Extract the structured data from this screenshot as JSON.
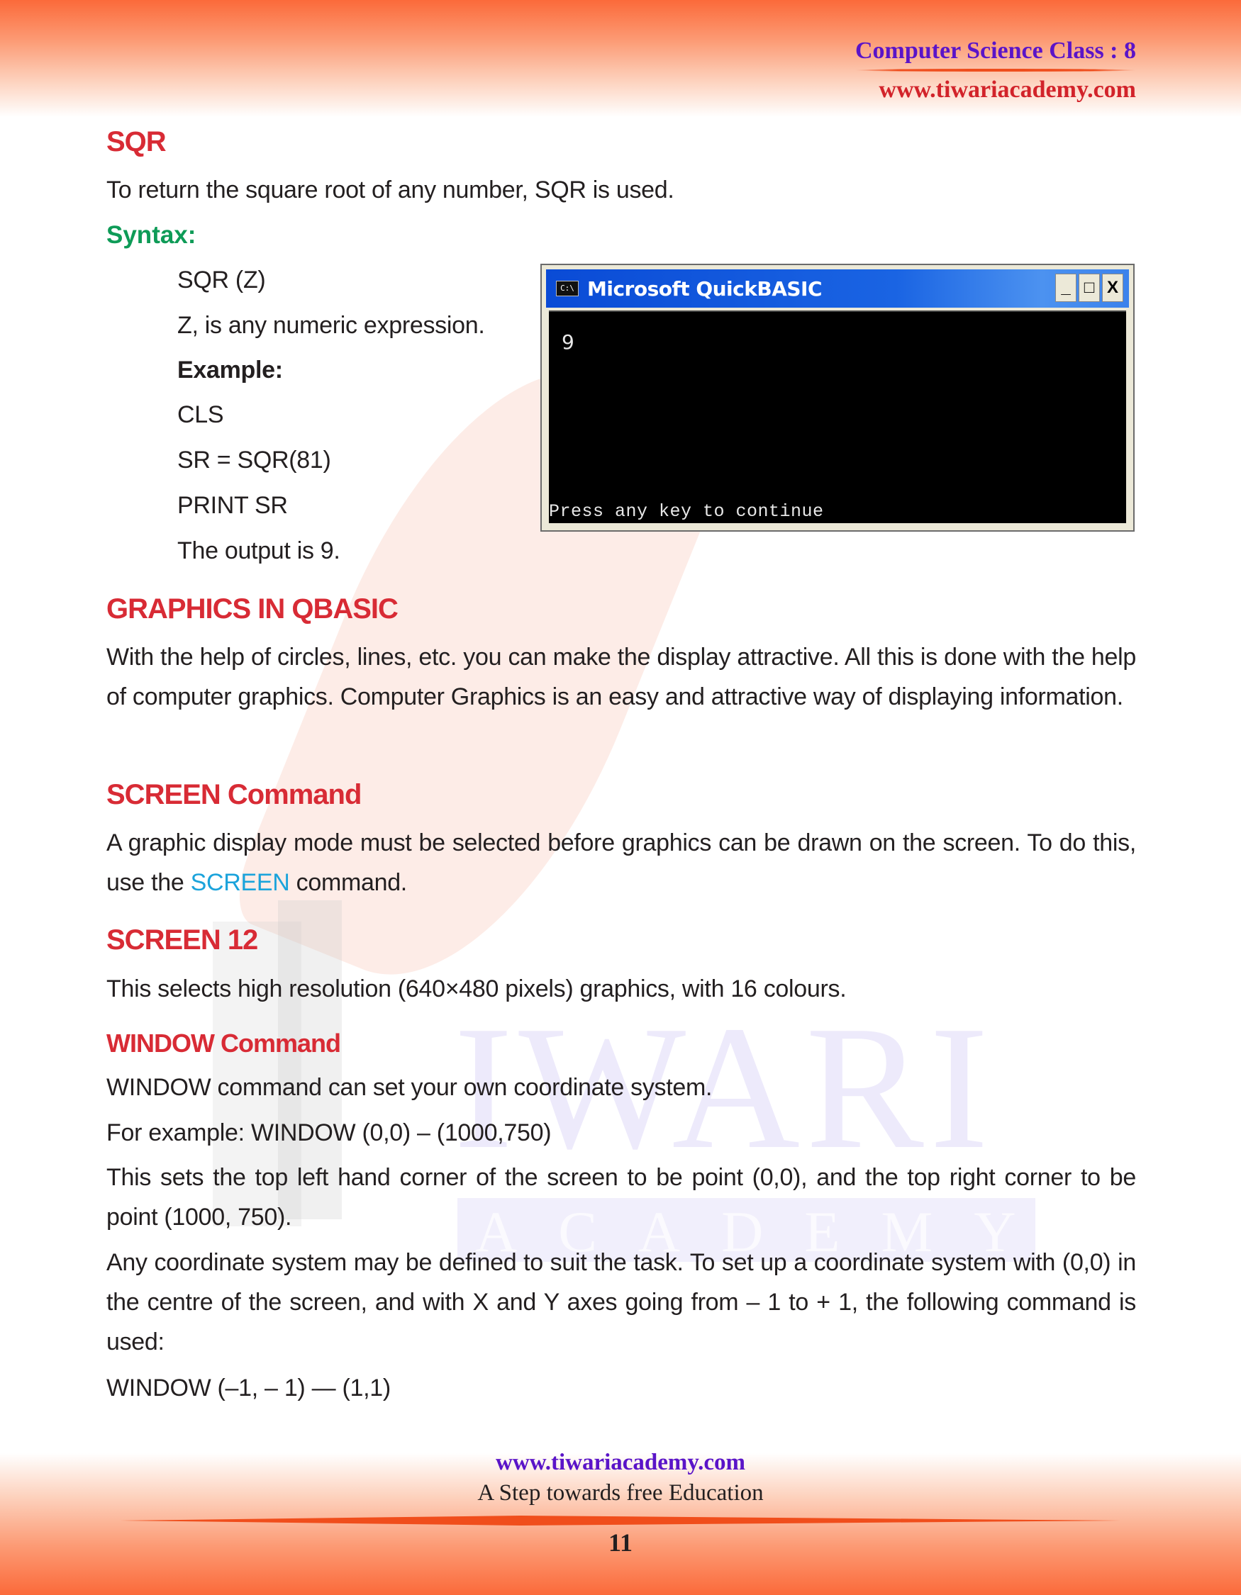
{
  "header": {
    "subject_class": "Computer Science Class : 8",
    "website": "www.tiwariacademy.com"
  },
  "watermark": {
    "word1": "IWARI",
    "word2": "ACADEMY"
  },
  "sqr": {
    "heading": "SQR",
    "description": "To return the square root of any number, SQR is used.",
    "syntax_label": "Syntax:",
    "syntax": "SQR (Z)",
    "syntax_note": "Z, is any numeric expression.",
    "example_label": "Example:",
    "code_lines": [
      "CLS",
      "SR = SQR(81)",
      "PRINT SR"
    ],
    "output_note": "The output is 9."
  },
  "qb_window": {
    "icon_text": "C:\\",
    "title": "Microsoft QuickBASIC",
    "minimize_label": "_",
    "maximize_label": "□",
    "close_label": "X",
    "output": "9",
    "prompt": "Press any key to continue"
  },
  "graphics": {
    "heading": "GRAPHICS IN QBASIC",
    "paragraph": "With the help of circles, lines, etc. you can make the display attractive. All this is done with the help of computer graphics. Computer Graphics is an easy and attractive way of displaying information."
  },
  "screen_command": {
    "heading": "SCREEN Command",
    "text_before": "A graphic display mode must be selected before graphics can be drawn on the screen. To do this, use the ",
    "highlight": "SCREEN",
    "text_after": " command."
  },
  "screen12": {
    "heading": "SCREEN 12",
    "paragraph": "This selects high resolution (640×480 pixels) graphics, with 16 colours."
  },
  "window_command": {
    "heading": "WINDOW Command",
    "line1": "WINDOW command can set your own coordinate system.",
    "line2": "For example: WINDOW (0,0) – (1000,750)",
    "line3": "This sets the top left hand corner of the screen to be point (0,0), and the top right corner to be point (1000, 750).",
    "line4": "Any coordinate system may be defined to suit the task. To set up a coordinate system with (0,0) in the centre of the screen, and with X and Y axes going from – 1 to + 1, the following command is used:",
    "line5": "WINDOW (–1, – 1) — (1,1)"
  },
  "footer": {
    "website": "www.tiwariacademy.com",
    "tagline": "A Step towards free Education",
    "page_number": "11"
  },
  "colors": {
    "heading_red": "#d82b35",
    "syntax_green": "#0e9b57",
    "highlight_blue": "#1ba3db",
    "brand_purple": "#5a14c8",
    "band_orange": "#fb6a3a"
  }
}
